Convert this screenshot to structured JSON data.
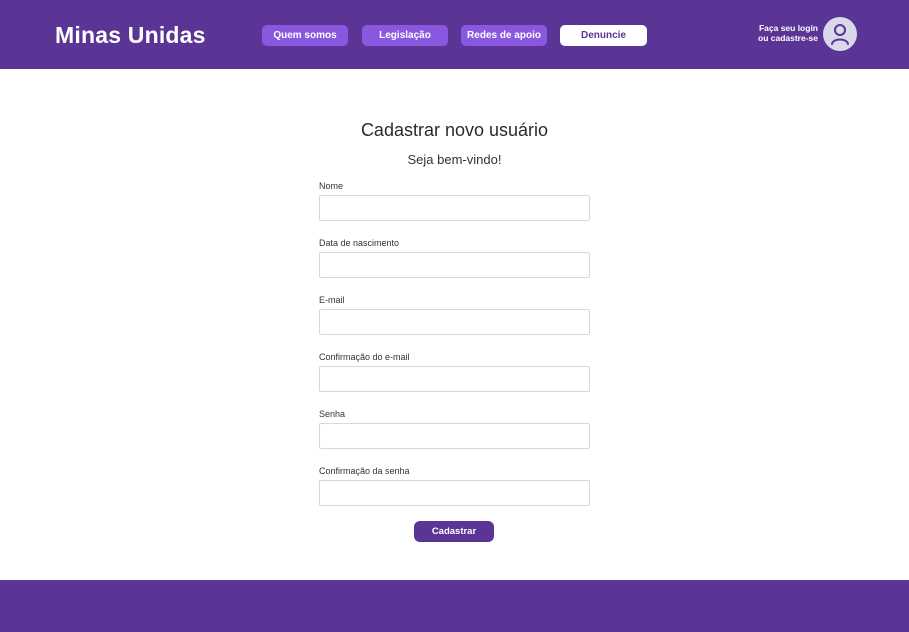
{
  "header": {
    "brand": "Minas Unidas",
    "nav": {
      "quem_somos": "Quem somos",
      "legislacao": "Legislação",
      "redes_apoio": "Redes de apoio",
      "denuncie": "Denuncie"
    },
    "login_line1": "Faça seu login",
    "login_line2": "ou cadastre-se",
    "avatar_icon": "user-icon"
  },
  "form": {
    "title": "Cadastrar novo usuário",
    "subtitle": "Seja bem-vindo!",
    "fields": {
      "nome": {
        "label": "Nome",
        "value": ""
      },
      "nascimento": {
        "label": "Data de nascimento",
        "value": ""
      },
      "email": {
        "label": "E-mail",
        "value": ""
      },
      "email_confirm": {
        "label": "Confirmação do e-mail",
        "value": ""
      },
      "senha": {
        "label": "Senha",
        "value": ""
      },
      "senha_confirm": {
        "label": "Confirmação da senha",
        "value": ""
      }
    },
    "submit_label": "Cadastrar"
  },
  "colors": {
    "brand": "#5a3596",
    "nav_button": "#8a57e0",
    "white": "#ffffff"
  }
}
